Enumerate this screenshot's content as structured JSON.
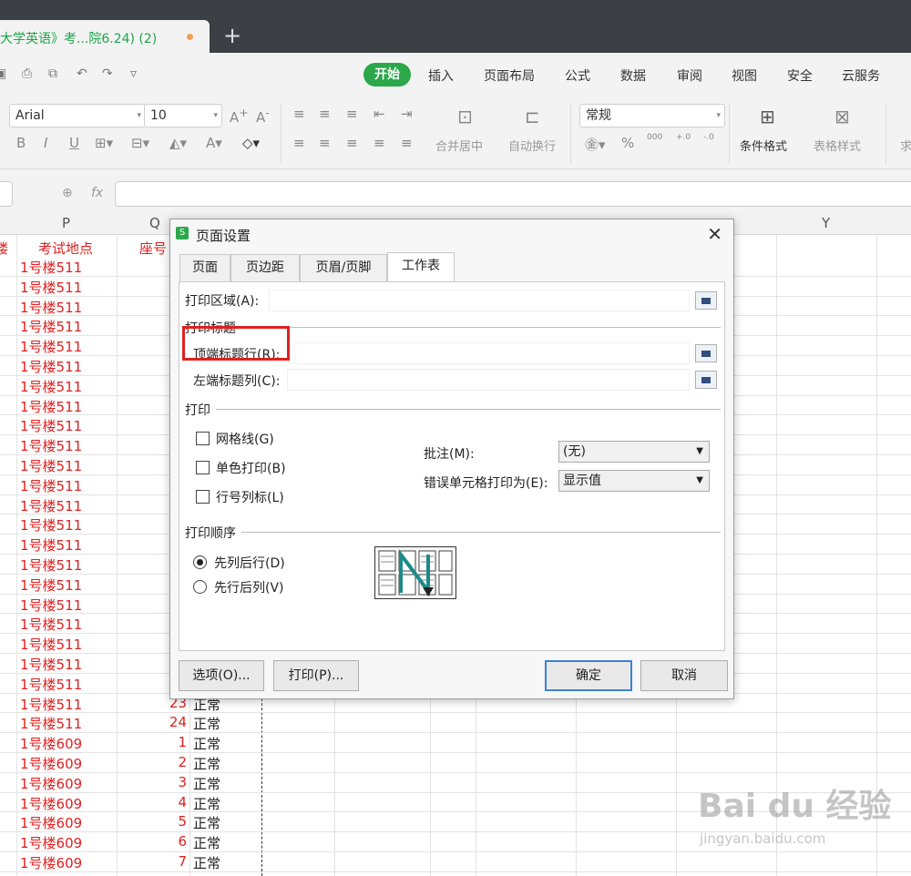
{
  "window": {
    "tab_title": "大学英语》考...院6.24) (2)",
    "new_tab": "+"
  },
  "menu": {
    "items": [
      "开始",
      "插入",
      "页面布局",
      "公式",
      "数据",
      "审阅",
      "视图",
      "安全",
      "云服务"
    ]
  },
  "toolbar": {
    "font_name": "Arial",
    "font_size": "10",
    "number_format": "常规",
    "merge_center": "合并居中",
    "wrap_text": "自动换行",
    "conditional_format": "条件格式",
    "table_style": "表格样式",
    "bold": "B",
    "italic": "I",
    "underline": "U",
    "percent": "%",
    "fx": "fx",
    "sum_partial": "求"
  },
  "grid": {
    "columns": [
      "P",
      "Q",
      "Y"
    ],
    "header_partial_left": "楼",
    "header_p": "考试地点",
    "header_q": "座号",
    "rows": [
      {
        "p": "1号楼511",
        "q": "",
        "r": ""
      },
      {
        "p": "1号楼511",
        "q": "",
        "r": ""
      },
      {
        "p": "1号楼511",
        "q": "",
        "r": ""
      },
      {
        "p": "1号楼511",
        "q": "",
        "r": ""
      },
      {
        "p": "1号楼511",
        "q": "",
        "r": ""
      },
      {
        "p": "1号楼511",
        "q": "",
        "r": ""
      },
      {
        "p": "1号楼511",
        "q": "",
        "r": ""
      },
      {
        "p": "1号楼511",
        "q": "",
        "r": ""
      },
      {
        "p": "1号楼511",
        "q": "",
        "r": ""
      },
      {
        "p": "1号楼511",
        "q": "",
        "r": ""
      },
      {
        "p": "1号楼511",
        "q": "",
        "r": ""
      },
      {
        "p": "1号楼511",
        "q": "",
        "r": ""
      },
      {
        "p": "1号楼511",
        "q": "",
        "r": ""
      },
      {
        "p": "1号楼511",
        "q": "",
        "r": ""
      },
      {
        "p": "1号楼511",
        "q": "",
        "r": ""
      },
      {
        "p": "1号楼511",
        "q": "",
        "r": ""
      },
      {
        "p": "1号楼511",
        "q": "",
        "r": ""
      },
      {
        "p": "1号楼511",
        "q": "",
        "r": ""
      },
      {
        "p": "1号楼511",
        "q": "",
        "r": ""
      },
      {
        "p": "1号楼511",
        "q": "",
        "r": ""
      },
      {
        "p": "1号楼511",
        "q": "",
        "r": ""
      },
      {
        "p": "1号楼511",
        "q": "",
        "r": ""
      },
      {
        "p": "1号楼511",
        "q": "23",
        "r": "正常"
      },
      {
        "p": "1号楼511",
        "q": "24",
        "r": "正常"
      },
      {
        "p": "1号楼609",
        "q": "1",
        "r": "正常"
      },
      {
        "p": "1号楼609",
        "q": "2",
        "r": "正常"
      },
      {
        "p": "1号楼609",
        "q": "3",
        "r": "正常"
      },
      {
        "p": "1号楼609",
        "q": "4",
        "r": "正常"
      },
      {
        "p": "1号楼609",
        "q": "5",
        "r": "正常"
      },
      {
        "p": "1号楼609",
        "q": "6",
        "r": "正常"
      },
      {
        "p": "1号楼609",
        "q": "7",
        "r": "正常"
      }
    ]
  },
  "dialog": {
    "title": "页面设置",
    "icon_letter": "S",
    "close": "✕",
    "tabs": [
      "页面",
      "页边距",
      "页眉/页脚",
      "工作表"
    ],
    "print_area_label": "打印区域(A):",
    "print_titles_group": "打印标题",
    "top_rows_label": "顶端标题行(R):",
    "left_cols_label": "左端标题列(C):",
    "print_group": "打印",
    "gridlines_label": "网格线(G)",
    "mono_label": "单色打印(B)",
    "rowcol_label": "行号列标(L)",
    "comments_label": "批注(M):",
    "comments_value": "(无)",
    "errors_label": "错误单元格打印为(E):",
    "errors_value": "显示值",
    "order_group": "打印顺序",
    "order_down_over": "先列后行(D)",
    "order_over_down": "先行后列(V)",
    "options_button": "选项(O)...",
    "print_button": "打印(P)...",
    "ok_button": "确定",
    "cancel_button": "取消"
  },
  "watermark": {
    "logo": "Bai du 经验",
    "url": "jingyan.baidu.com"
  }
}
